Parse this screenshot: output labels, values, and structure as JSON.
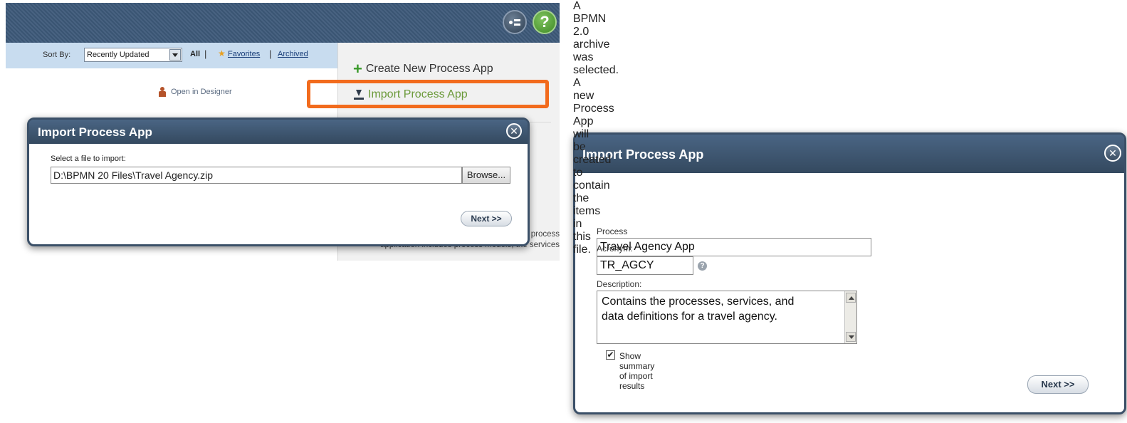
{
  "header": {
    "designer_icon": "designer-icon",
    "help_icon": "help-icon",
    "help_glyph": "?"
  },
  "sort_bar": {
    "label": "Sort By:",
    "selected": "Recently Updated",
    "filters": {
      "all": "All",
      "favorites": "Favorites",
      "archived": "Archived"
    },
    "separator": "|"
  },
  "library": {
    "open_in_designer": "Open in Designer"
  },
  "actions": {
    "create_new": "Create New Process App",
    "import": "Import Process App",
    "highlight_color": "#f26b1d"
  },
  "panel": {
    "description_partial": "ated in IBM Process Designer. Ordinarily, a process application includes process models, the services"
  },
  "dialog_select": {
    "title": "Import Process App",
    "close_glyph": "✕",
    "file_label": "Select a file to import:",
    "file_value": "D:\\BPMN 20 Files\\Travel Agency.zip",
    "browse_label": "Browse...",
    "next_label": "Next >>"
  },
  "dialog_details": {
    "title": "Import Process App",
    "close_glyph": "✕",
    "info_text": "A BPMN 2.0 archive was selected. A new Process App will be created to contain the items in this file.",
    "name_label": "Process App Name:",
    "name_value": "Travel Agency App",
    "acronym_label": "Acronym:",
    "acronym_value": "TR_AGCY",
    "description_label": "Description:",
    "description_line1": "Contains the processes, services, and",
    "description_line2": "data definitions for a travel agency.",
    "show_summary_label": "Show summary of import results",
    "show_summary_checked": "✔",
    "next_label": "Next >>"
  },
  "colors": {
    "header_bg": "#3e5a7a",
    "sortbar_bg": "#c8dcef",
    "dialog_header": "#3b5068",
    "link": "#1a3f7a"
  }
}
